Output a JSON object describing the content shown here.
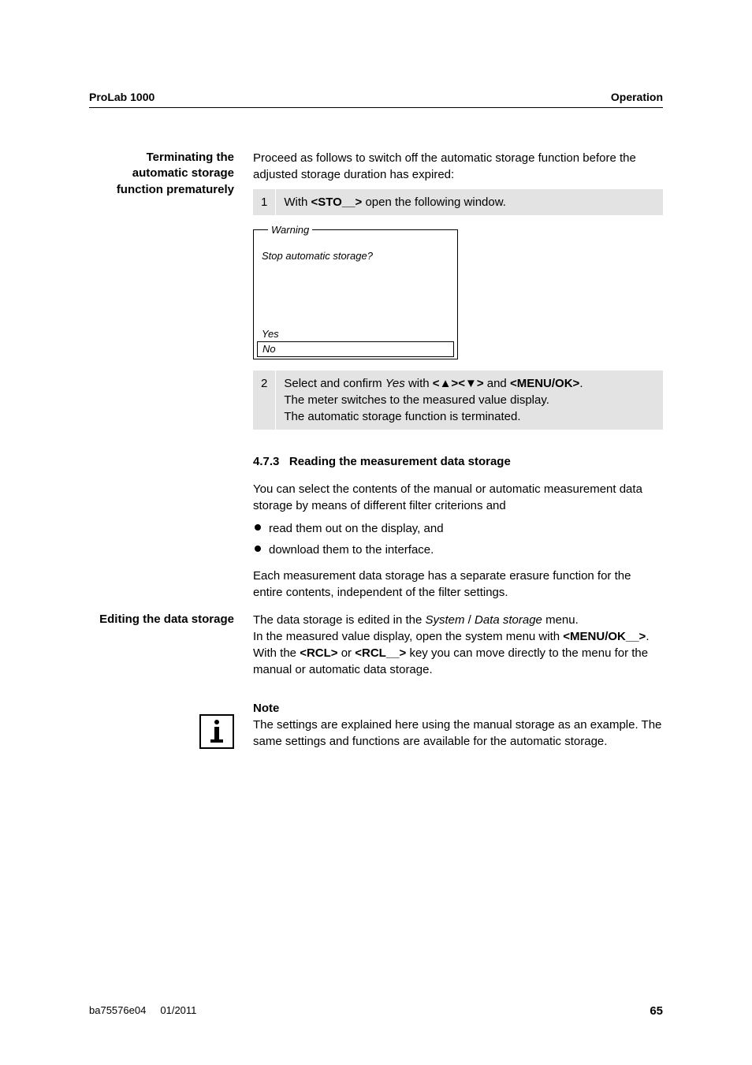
{
  "header": {
    "left": "ProLab 1000",
    "right": "Operation"
  },
  "sec1": {
    "sidehead": "Terminating the automatic storage function prematurely",
    "intro": "Proceed as follows to switch off the automatic storage function before the adjusted storage duration has expired:",
    "step1_num": "1",
    "step1_a": "With ",
    "step1_key": "<STO__>",
    "step1_b": " open the following window.",
    "device": {
      "title": "Warning",
      "msg": "Stop automatic storage?",
      "yes": "Yes",
      "no": "No"
    },
    "step2_num": "2",
    "step2_a": "Select and confirm ",
    "step2_yes": "Yes",
    "step2_b": " with ",
    "step2_key1a": "<",
    "step2_key1b": ">",
    "step2_key2a": "<",
    "step2_key2b": ">",
    "step2_and": " and ",
    "step2_key3": "<MENU/OK>",
    "step2_line2": "The meter switches to the measured value display.",
    "step2_line3": "The automatic storage function is terminated."
  },
  "sec2": {
    "num": "4.7.3",
    "title": "Reading the measurement data storage",
    "p1": "You can select the contents of the manual or automatic measurement data storage by means of different filter criterions and",
    "b1": "read them out on the display, and",
    "b2": "download them to the interface.",
    "p2": "Each measurement data storage has a separate erasure function for the entire contents, independent of the filter settings."
  },
  "sec3": {
    "sidehead": "Editing the data storage",
    "p_a": "The data storage is edited in the ",
    "p_i1": "System",
    "p_slash": " / ",
    "p_i2": "Data storage",
    "p_b": " menu.\nIn the measured value display, open the system menu with ",
    "p_key1": "<MENU/OK__>",
    "p_c": ". With the ",
    "p_key2": "<RCL>",
    "p_d": " or ",
    "p_key3": "<RCL__>",
    "p_e": " key you can move directly to the menu for the manual or automatic data storage."
  },
  "note": {
    "head": "Note",
    "body": "The settings are explained here using the manual storage as an example. The same settings and functions are available for the automatic storage."
  },
  "footer": {
    "left1": "ba75576e04",
    "left2": "01/2011",
    "page": "65"
  }
}
